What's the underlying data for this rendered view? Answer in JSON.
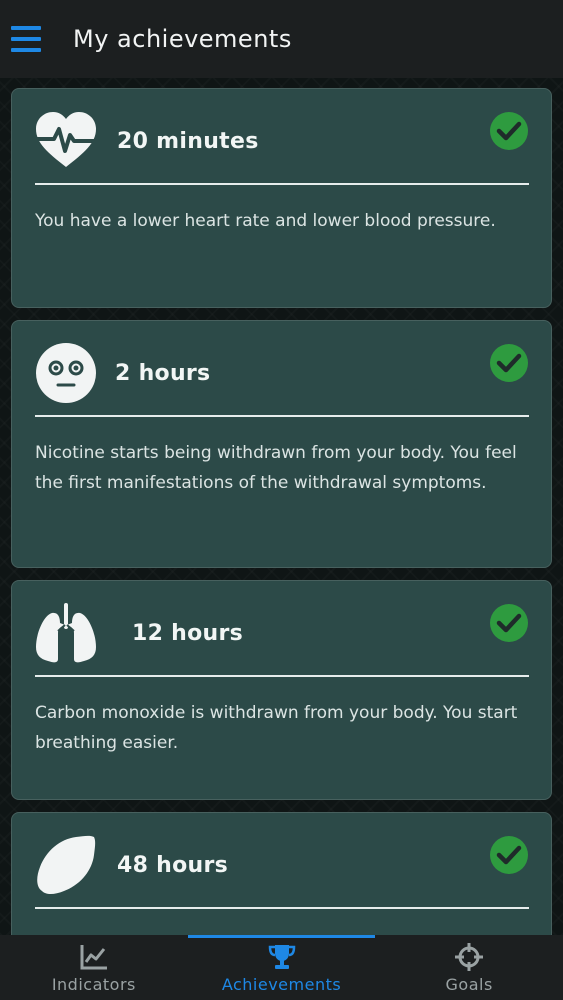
{
  "app_bar": {
    "menu_icon": "hamburger-menu-icon",
    "title": "My achievements"
  },
  "colors": {
    "accent": "#1e88e5",
    "card_bg": "#2c4a48",
    "check": "#2e9b3f",
    "app_bar_bg": "#1c1f20"
  },
  "achievements": [
    {
      "icon": "heart-pulse-icon",
      "title": "20 minutes",
      "description": "You have a lower heart rate and lower blood pressure.",
      "completed": true
    },
    {
      "icon": "neutral-face-icon",
      "title": "2 hours",
      "description": "Nicotine starts being withdrawn from your body. You feel the first manifestations of the withdrawal symptoms.",
      "completed": true
    },
    {
      "icon": "lungs-icon",
      "title": "12 hours",
      "description": "Carbon monoxide is withdrawn from your body. You start breathing easier.",
      "completed": true
    },
    {
      "icon": "lemon-icon",
      "title": "48 hours",
      "description": "",
      "completed": true
    }
  ],
  "bottom_nav": {
    "items": [
      {
        "label": "Indicators",
        "icon": "line-chart-icon",
        "active": false
      },
      {
        "label": "Achievements",
        "icon": "trophy-icon",
        "active": true
      },
      {
        "label": "Goals",
        "icon": "crosshair-icon",
        "active": false
      }
    ]
  }
}
